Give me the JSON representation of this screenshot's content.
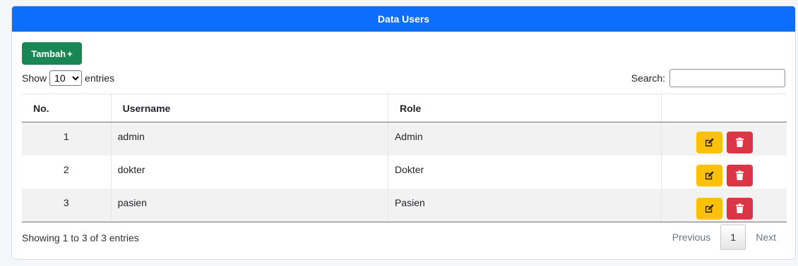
{
  "card": {
    "title": "Data Users"
  },
  "add_button": {
    "label": "Tambah",
    "suffix": "+"
  },
  "length_control": {
    "prefix": "Show",
    "selected": "10",
    "suffix": "entries"
  },
  "search": {
    "label": "Search:",
    "value": "",
    "placeholder": ""
  },
  "table": {
    "headers": [
      "No.",
      "Username",
      "Role",
      ""
    ],
    "rows": [
      {
        "no": "1",
        "username": "admin",
        "role": "Admin"
      },
      {
        "no": "2",
        "username": "dokter",
        "role": "Dokter"
      },
      {
        "no": "3",
        "username": "pasien",
        "role": "Pasien"
      }
    ],
    "row_actions": [
      "edit-icon",
      "trash-icon"
    ]
  },
  "footer": {
    "info": "Showing 1 to 3 of 3 entries",
    "previous": "Previous",
    "current_page": "1",
    "next": "Next"
  },
  "colors": {
    "header_blue": "#0d6efd",
    "add_green": "#198754",
    "edit_yellow": "#ffc107",
    "delete_red": "#dc3545"
  }
}
